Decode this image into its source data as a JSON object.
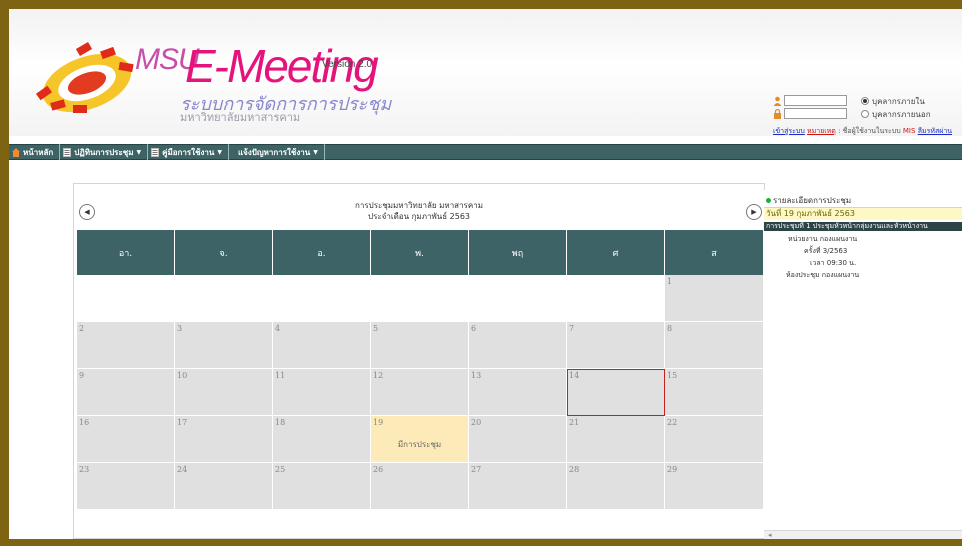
{
  "header": {
    "logo_msu": "MSU",
    "logo_name": "E-Meeting",
    "version": "Version 2.0",
    "subtitle": "ระบบการจัดการการประชุม",
    "university": "มหาวิทยาลัยมหาสารคาม"
  },
  "login": {
    "username_value": "",
    "password_value": "",
    "radio_internal": "บุคลากรภายใน",
    "radio_external": "บุคลากรภายนอก",
    "selected": "internal",
    "note_prefix": "เข้าสู่ระบบ",
    "note_red": "หมายเหตุ",
    "note_middle": ": ชื่อผู้ใช้งานในระบบ",
    "note_mis": "MIS",
    "note_blue": "ลืมรหัสผ่าน"
  },
  "nav": {
    "items": [
      {
        "label": "หน้าหลัก",
        "icon": "home-icon",
        "dropdown": false
      },
      {
        "label": "ปฏิทินการประชุม",
        "icon": "calendar-icon",
        "dropdown": true
      },
      {
        "label": "คู่มือการใช้งาน",
        "icon": "book-icon",
        "dropdown": true
      },
      {
        "label": "แจ้งปัญหาการใช้งาน",
        "icon": "",
        "dropdown": true
      }
    ]
  },
  "calendar": {
    "title_line1": "การประชุมมหาวิทยาลัย มหาสารคาม",
    "title_line2": "ประจำเดือน กุมภาพันธ์ 2563",
    "prev_icon": "◀",
    "next_icon": "▶",
    "weekdays": [
      "อา.",
      "จ.",
      "อ.",
      "พ.",
      "พฤ",
      "ศ",
      "ส"
    ],
    "weeks": [
      [
        "",
        "",
        "",
        "",
        "",
        "",
        "1"
      ],
      [
        "2",
        "3",
        "4",
        "5",
        "6",
        "7",
        "8"
      ],
      [
        "9",
        "10",
        "11",
        "12",
        "13",
        "14",
        "15"
      ],
      [
        "16",
        "17",
        "18",
        "19",
        "20",
        "21",
        "22"
      ],
      [
        "23",
        "24",
        "25",
        "26",
        "27",
        "28",
        "29"
      ]
    ],
    "today": "14",
    "event_day": "19",
    "event_label": "มีการประชุม"
  },
  "detail": {
    "heading": "รายละเอียดการประชุม",
    "date": "วันที่ 19 กุมภาพันธ์ 2563",
    "meeting_bar": "การประชุมที่ 1 ประชุมหัวหน้ากลุ่มงานและหัวหน้างาน",
    "unit": "หน่วยงาน กองแผนงาน",
    "session": "ครั้งที่ 3/2563",
    "time": "เวลา 09:30 น.",
    "room": "ห้องประชุม กองแผนงาน",
    "scroll_glyph": "◂"
  },
  "colors": {
    "frame": "#7e6412",
    "navbar": "#3d6365",
    "weekday_header": "#3e6366",
    "event_cell": "#fcebb8",
    "today_border": "#c62020"
  }
}
